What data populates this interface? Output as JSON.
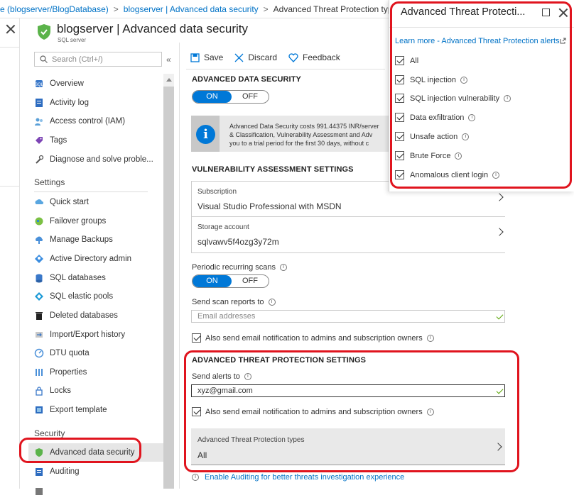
{
  "breadcrumb": {
    "items": [
      "e (blogserver/BlogDatabase)",
      "blogserver | Advanced data security",
      "Advanced Threat Protection types"
    ],
    "separator": ">"
  },
  "header": {
    "title": "blogserver | Advanced data security",
    "subtitle": "SQL server"
  },
  "search": {
    "placeholder": "Search (Ctrl+/)",
    "collapse_glyph": "«"
  },
  "nav": {
    "items_top": [
      {
        "label": "Overview",
        "icon": "sql-server-icon"
      },
      {
        "label": "Activity log",
        "icon": "activity-log-icon"
      },
      {
        "label": "Access control (IAM)",
        "icon": "people-icon"
      },
      {
        "label": "Tags",
        "icon": "tag-icon"
      },
      {
        "label": "Diagnose and solve proble...",
        "icon": "wrench-icon"
      }
    ],
    "section_settings": "Settings",
    "items_settings": [
      {
        "label": "Quick start",
        "icon": "cloud-icon"
      },
      {
        "label": "Failover groups",
        "icon": "globe-icon"
      },
      {
        "label": "Manage Backups",
        "icon": "backup-icon"
      },
      {
        "label": "Active Directory admin",
        "icon": "ad-admin-icon"
      },
      {
        "label": "SQL databases",
        "icon": "database-icon"
      },
      {
        "label": "SQL elastic pools",
        "icon": "elastic-pool-icon"
      },
      {
        "label": "Deleted databases",
        "icon": "trash-icon"
      },
      {
        "label": "Import/Export history",
        "icon": "import-export-icon"
      },
      {
        "label": "DTU quota",
        "icon": "gauge-icon"
      },
      {
        "label": "Properties",
        "icon": "properties-icon"
      },
      {
        "label": "Locks",
        "icon": "lock-icon"
      },
      {
        "label": "Export template",
        "icon": "export-template-icon"
      }
    ],
    "section_security": "Security",
    "items_security": [
      {
        "label": "Advanced data security",
        "icon": "shield-icon",
        "selected": true
      },
      {
        "label": "Auditing",
        "icon": "auditing-icon"
      }
    ]
  },
  "toolbar": {
    "save": "Save",
    "discard": "Discard",
    "feedback": "Feedback"
  },
  "ads": {
    "heading": "ADVANCED DATA SECURITY",
    "toggle_on": "ON",
    "toggle_off": "OFF",
    "info_lines": [
      "Advanced Data Security costs 991.44375 INR/server",
      "& Classification, Vulnerability Assessment and Adv",
      "you to a trial period for the first 30 days, without c"
    ]
  },
  "va": {
    "heading": "VULNERABILITY ASSESSMENT SETTINGS",
    "subscription_label": "Subscription",
    "subscription_value": "Visual Studio Professional with MSDN",
    "storage_label": "Storage account",
    "storage_value": "sqlvawv5f4ozg3y72m",
    "scans_label": "Periodic recurring scans",
    "scans_on": "ON",
    "scans_off": "OFF",
    "reports_label": "Send scan reports to",
    "reports_placeholder": "Email addresses",
    "also_send": "Also send email notification to admins and subscription owners"
  },
  "atp": {
    "heading": "ADVANCED THREAT PROTECTION SETTINGS",
    "alerts_label": "Send alerts to",
    "alerts_value": "xyz@gmail.com",
    "also_send": "Also send email notification to admins and subscription owners",
    "types_label": "Advanced Threat Protection types",
    "types_value": "All",
    "auditing_link": "Enable Auditing for better threats investigation experience"
  },
  "popup": {
    "title": "Advanced Threat Protecti...",
    "link": "Learn more - Advanced Threat Protection alerts",
    "options": [
      {
        "label": "All",
        "checked": true,
        "info": false
      },
      {
        "label": "SQL injection",
        "checked": true,
        "info": true
      },
      {
        "label": "SQL injection vulnerability",
        "checked": true,
        "info": true
      },
      {
        "label": "Data exfiltration",
        "checked": true,
        "info": true
      },
      {
        "label": "Unsafe action",
        "checked": true,
        "info": true
      },
      {
        "label": "Brute Force",
        "checked": true,
        "info": true
      },
      {
        "label": "Anomalous client login",
        "checked": true,
        "info": true
      }
    ]
  },
  "colors": {
    "accent": "#0078d7",
    "link": "#0072c6",
    "annotation_red": "#e0141e",
    "valid_green": "#57a300"
  }
}
